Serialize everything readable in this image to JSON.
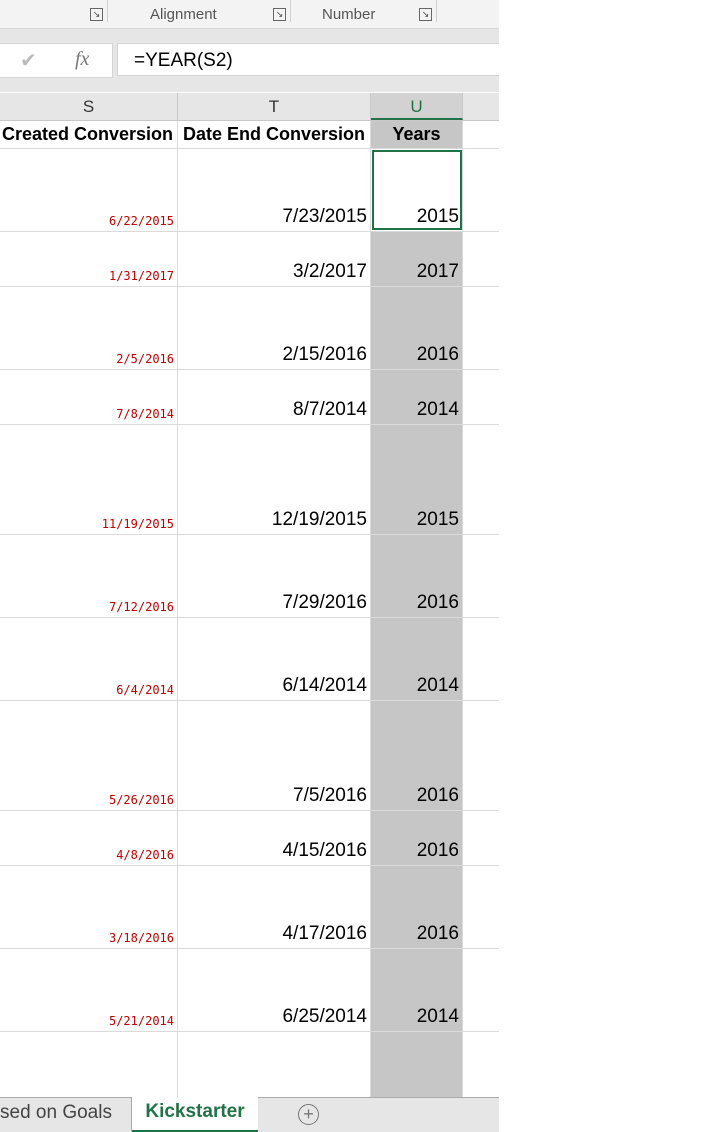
{
  "ribbon": {
    "groups": [
      "Alignment",
      "Number"
    ]
  },
  "formula_bar": {
    "confirm_icon": "check-icon",
    "fx_label": "fx",
    "formula": "=YEAR(S2)"
  },
  "columns": [
    "S",
    "T",
    "U"
  ],
  "headers": {
    "s": "Created Conversion",
    "t": "Date End Conversion",
    "u": "Years"
  },
  "rows": [
    {
      "s": "6/22/2015",
      "t": "7/23/2015",
      "u": "2015"
    },
    {
      "s": "1/31/2017",
      "t": "3/2/2017",
      "u": "2017"
    },
    {
      "s": "2/5/2016",
      "t": "2/15/2016",
      "u": "2016"
    },
    {
      "s": "7/8/2014",
      "t": "8/7/2014",
      "u": "2014"
    },
    {
      "s": "11/19/2015",
      "t": "12/19/2015",
      "u": "2015"
    },
    {
      "s": "7/12/2016",
      "t": "7/29/2016",
      "u": "2016"
    },
    {
      "s": "6/4/2014",
      "t": "6/14/2014",
      "u": "2014"
    },
    {
      "s": "5/26/2016",
      "t": "7/5/2016",
      "u": "2016"
    },
    {
      "s": "4/8/2016",
      "t": "4/15/2016",
      "u": "2016"
    },
    {
      "s": "3/18/2016",
      "t": "4/17/2016",
      "u": "2016"
    },
    {
      "s": "5/21/2014",
      "t": "6/25/2014",
      "u": "2014"
    },
    {
      "s": "",
      "t": "",
      "u": ""
    }
  ],
  "sheet_tabs": [
    "sed on Goals",
    "Kickstarter"
  ],
  "colors": {
    "accent": "#217346",
    "date_red": "#c00000"
  }
}
